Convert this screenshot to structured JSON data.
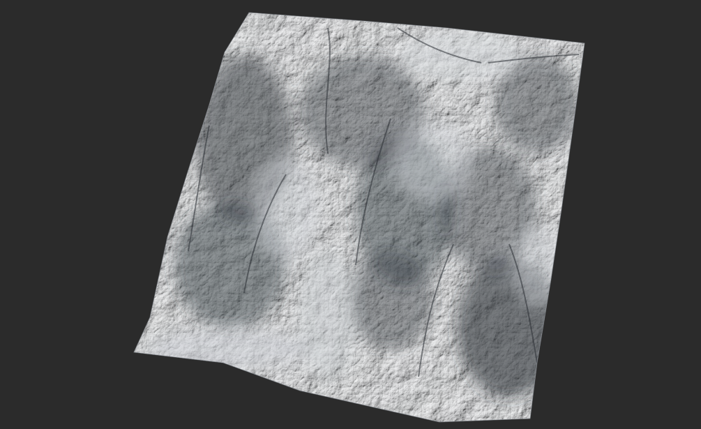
{
  "scene": {
    "background_color": "#2b2b2b",
    "subject": "terrain-heightmap-render",
    "terrain": {
      "base_color": "#a9aeb4",
      "highlight_color": "#c9ced3",
      "shadow_color": "#2f3338"
    }
  }
}
